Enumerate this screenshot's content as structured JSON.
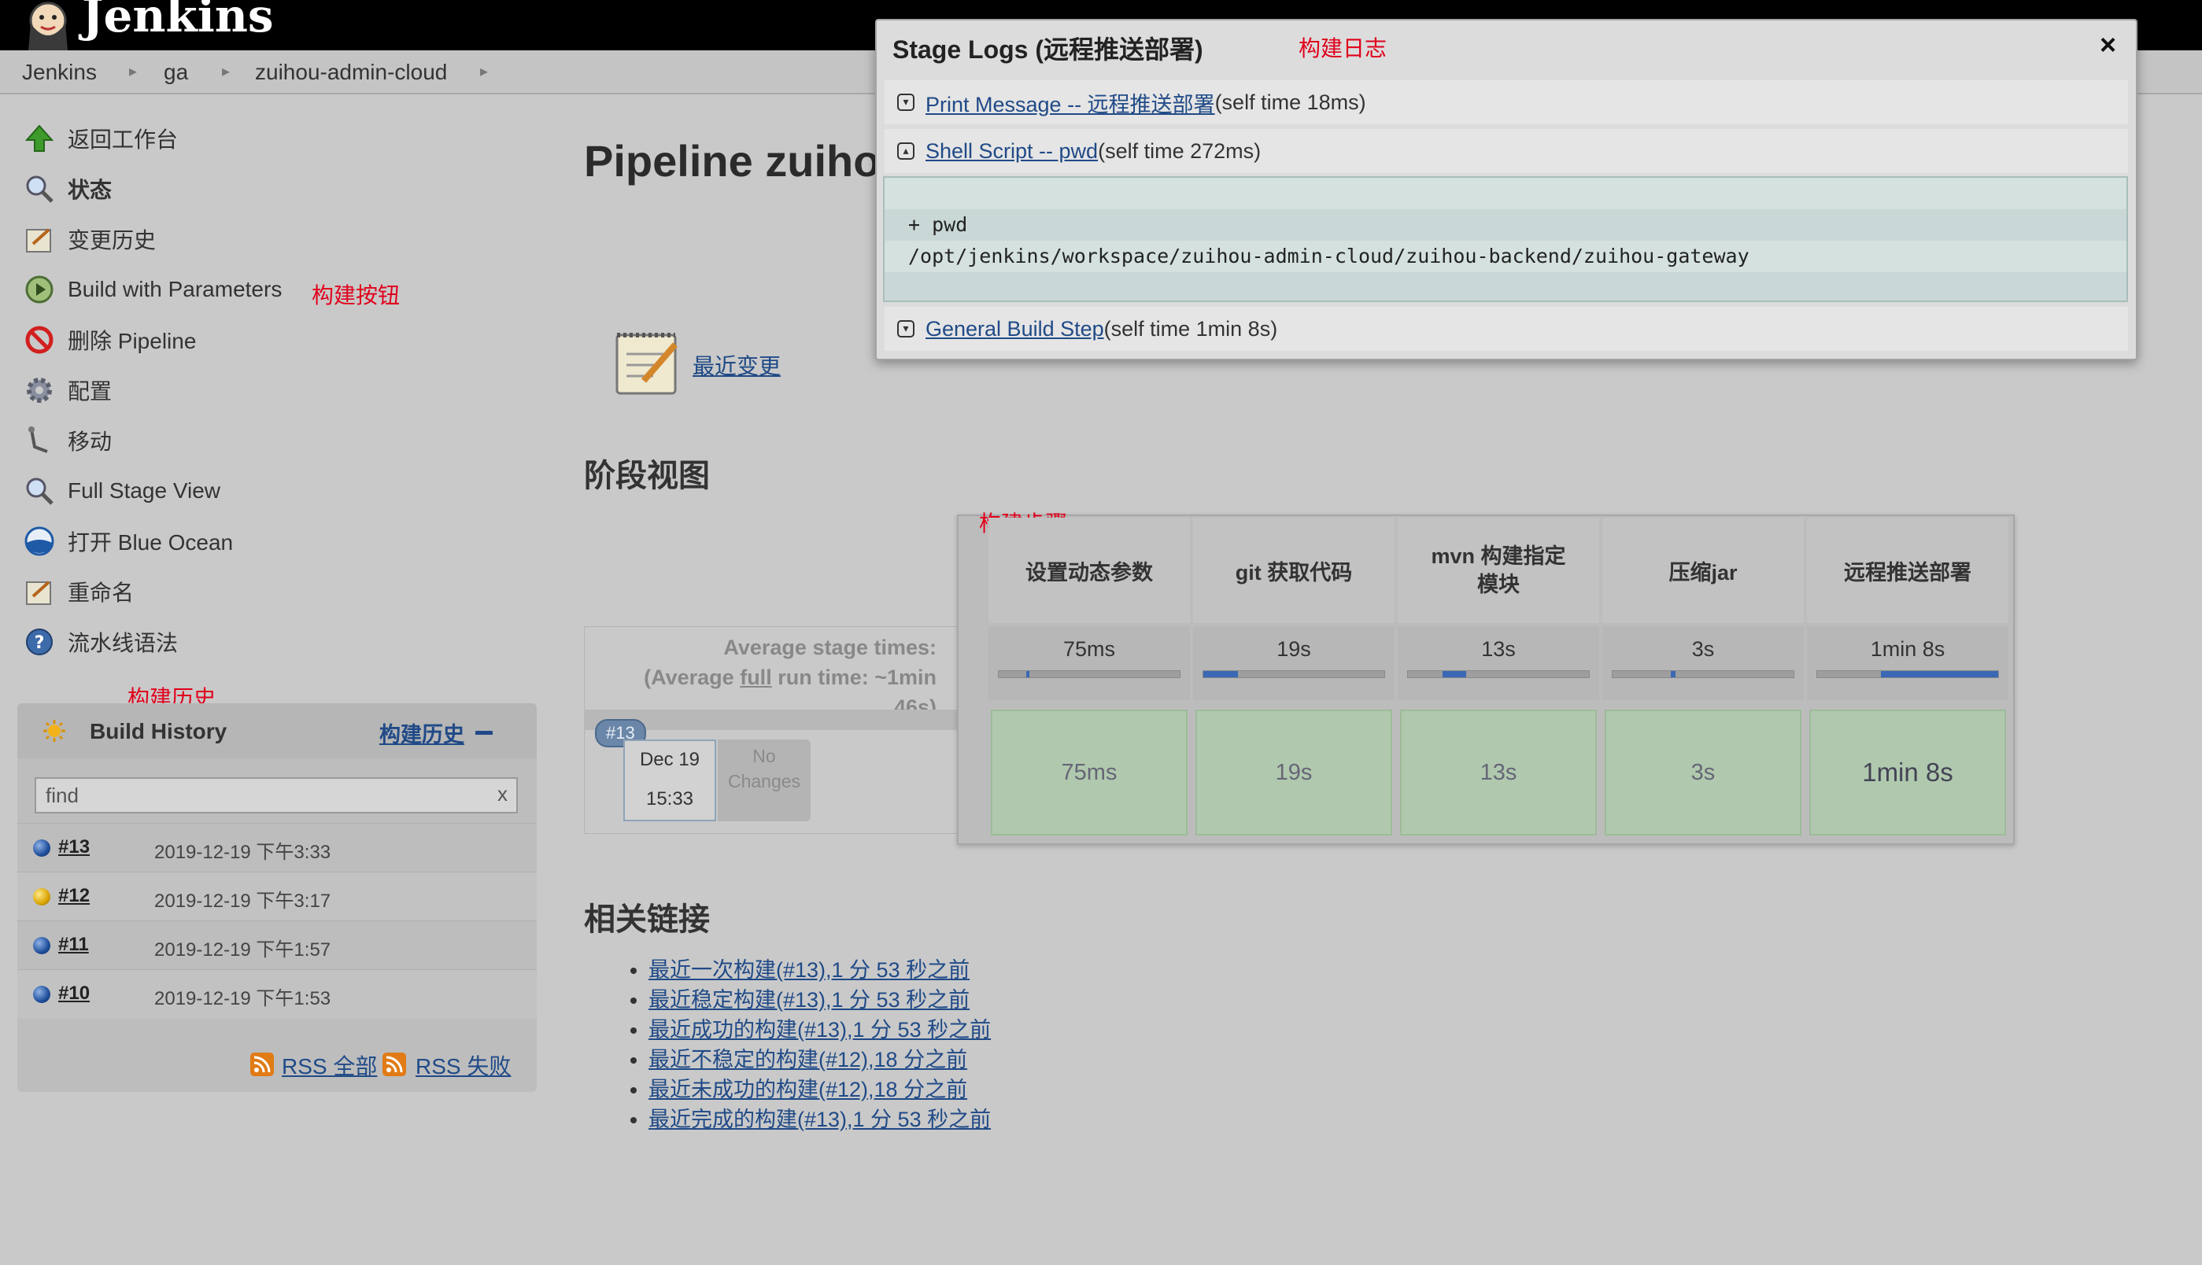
{
  "header": {
    "title": "Jenkins"
  },
  "breadcrumb": [
    "Jenkins",
    "ga",
    "zuihou-admin-cloud"
  ],
  "sidebar": {
    "items": [
      {
        "label": "返回工作台",
        "icon": "up-arrow-icon"
      },
      {
        "label": "状态",
        "icon": "magnifier-icon"
      },
      {
        "label": "变更历史",
        "icon": "notepad-icon"
      },
      {
        "label": "Build with Parameters",
        "icon": "clock-play-icon"
      },
      {
        "label": "删除 Pipeline",
        "icon": "no-entry-icon"
      },
      {
        "label": "配置",
        "icon": "gear-icon"
      },
      {
        "label": "移动",
        "icon": "move-arm-icon"
      },
      {
        "label": "Full Stage View",
        "icon": "magnifier-icon"
      },
      {
        "label": "打开 Blue Ocean",
        "icon": "blue-ocean-icon"
      },
      {
        "label": "重命名",
        "icon": "notepad-icon"
      },
      {
        "label": "流水线语法",
        "icon": "help-icon"
      }
    ]
  },
  "annotations": {
    "build_button": "构建按钮",
    "build_history": "构建历史",
    "build_steps": "构建步骤",
    "build_logs": "构建日志"
  },
  "build_history": {
    "title": "Build History",
    "trend_link": "构建历史",
    "search_placeholder": "find",
    "clear": "x",
    "builds": [
      {
        "number": "#13",
        "time": "2019-12-19 下午3:33",
        "status": "blue"
      },
      {
        "number": "#12",
        "time": "2019-12-19 下午3:17",
        "status": "yellow"
      },
      {
        "number": "#11",
        "time": "2019-12-19 下午1:57",
        "status": "blue"
      },
      {
        "number": "#10",
        "time": "2019-12-19 下午1:53",
        "status": "blue"
      }
    ],
    "rss_all": "RSS 全部",
    "rss_fail": "RSS 失败"
  },
  "main": {
    "title": "Pipeline zuiho",
    "recent_changes": "最近变更",
    "stage_view_heading": "阶段视图",
    "related_heading": "相关链接"
  },
  "stage_view": {
    "avg_line1": "Average stage times:",
    "avg_line2_pre": "(Average ",
    "avg_line2_link": "full",
    "avg_line2_post": " run time: ~1min",
    "avg_line3": "46s)",
    "run_badge": "#13",
    "run_date": "Dec 19",
    "run_time": "15:33",
    "no_changes_1": "No",
    "no_changes_2": "Changes",
    "stages": [
      {
        "name": "设置动态参数",
        "avg": "75ms",
        "cell": "75ms",
        "bar_start": 0.15,
        "bar_len": 0.02
      },
      {
        "name": "git 获取代码",
        "avg": "19s",
        "cell": "19s",
        "bar_start": 0.0,
        "bar_len": 0.19
      },
      {
        "name": "mvn 构建指定模块",
        "avg": "13s",
        "cell": "13s",
        "bar_start": 0.19,
        "bar_len": 0.13
      },
      {
        "name": "压缩jar",
        "avg": "3s",
        "cell": "3s",
        "bar_start": 0.32,
        "bar_len": 0.03
      },
      {
        "name": "远程推送部署",
        "avg": "1min 8s",
        "cell": "1min 8s",
        "bar_start": 0.35,
        "bar_len": 0.65
      }
    ]
  },
  "stage_logs": {
    "title": "Stage Logs (远程推送部署)",
    "close": "×",
    "entries": [
      {
        "link": "Print Message -- 远程推送部署 ",
        "time": "(self time 18ms)",
        "expanded": false
      },
      {
        "link": "Shell Script -- pwd ",
        "time": "(self time 272ms)",
        "expanded": true
      },
      {
        "link": "General Build Step ",
        "time": "(self time 1min 8s)",
        "expanded": false
      }
    ],
    "console_lines": [
      "+ pwd",
      "/opt/jenkins/workspace/zuihou-admin-cloud/zuihou-backend/zuihou-gateway"
    ]
  },
  "related_links": [
    "最近一次构建(#13),1 分 53 秒之前",
    "最近稳定构建(#13),1 分 53 秒之前",
    "最近成功的构建(#13),1 分 53 秒之前",
    "最近不稳定的构建(#12),18 分之前",
    "最近未成功的构建(#12),18 分之前",
    "最近完成的构建(#13),1 分 53 秒之前"
  ]
}
